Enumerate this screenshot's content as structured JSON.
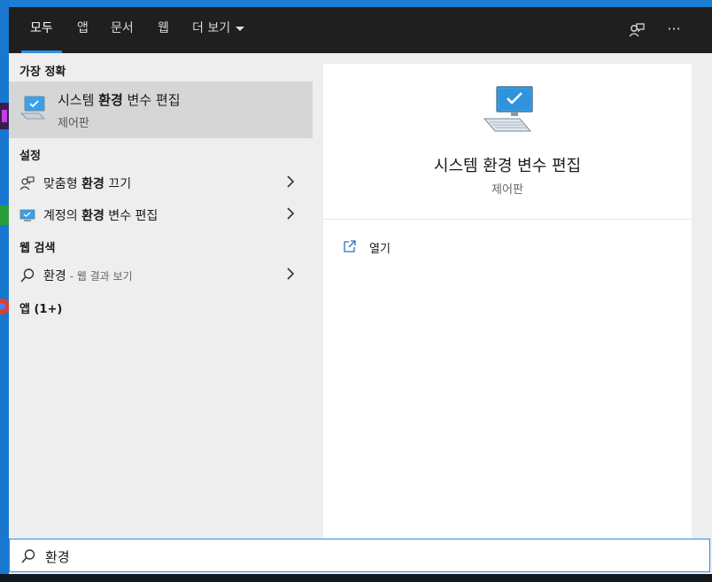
{
  "tabs": [
    {
      "label": "모두",
      "active": true
    },
    {
      "label": "앱"
    },
    {
      "label": "문서"
    },
    {
      "label": "웹"
    },
    {
      "label": "더 보기"
    }
  ],
  "top_buttons": {
    "feedback_icon": "person-feedback-icon",
    "more_icon": "ellipsis-icon",
    "more_glyph": "···"
  },
  "left": {
    "best_match_header": "가장 정확",
    "best_match": {
      "prefix": "시스템 ",
      "bold": "환경",
      "suffix": " 변수 편집",
      "subtitle": "제어판",
      "icon": "system-monitor-icon"
    },
    "settings_header": "설정",
    "settings": [
      {
        "prefix": "맞춤형 ",
        "bold": "환경",
        "suffix": " 끄기",
        "icon": "person-feedback-icon"
      },
      {
        "prefix": "계정의 ",
        "bold": "환경",
        "suffix": " 변수 편집",
        "icon": "system-monitor-icon"
      }
    ],
    "web_header": "웹 검색",
    "web": {
      "term": "환경",
      "suffix": " - 웹 결과 보기",
      "icon": "search-icon"
    },
    "apps_header": "앱 (1+)"
  },
  "right": {
    "title": "시스템 환경 변수 편집",
    "subtitle": "제어판",
    "actions": [
      {
        "label": "열기",
        "icon": "open-icon"
      }
    ]
  },
  "search": {
    "value": "환경",
    "icon": "search-icon"
  },
  "colors": {
    "accent": "#2d8ce6",
    "topbar": "#1f1f1f",
    "selected": "#d6d6d6",
    "panel": "#eeeeee"
  }
}
